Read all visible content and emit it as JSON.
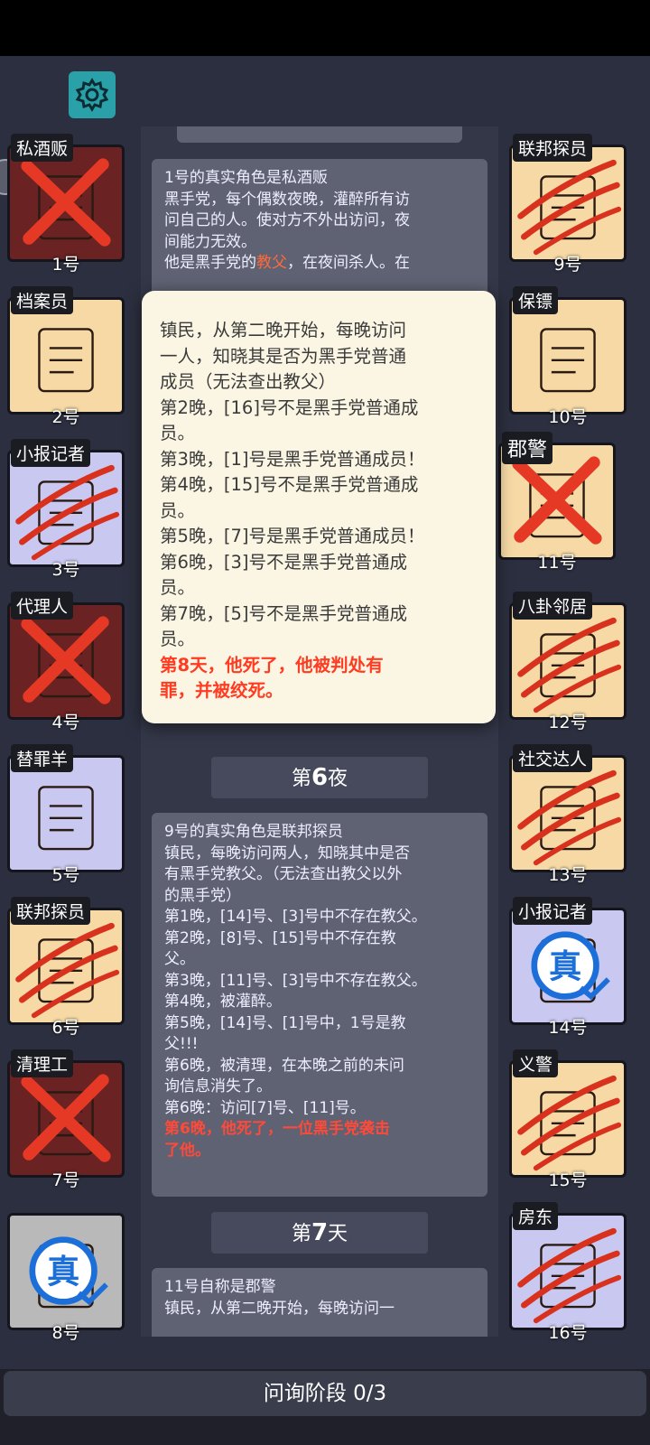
{
  "settings_icon": "gear-icon",
  "colors": {
    "accent_teal": "#2aa0a8",
    "dead_red": "#e53925",
    "claw_red": "#d8321f",
    "true_blue": "#1c6fd9"
  },
  "left_players": [
    {
      "role": "私酒贩",
      "num": "1号",
      "status": "dead-x"
    },
    {
      "role": "档案员",
      "num": "2号",
      "status": "alive"
    },
    {
      "role": "小报记者",
      "num": "3号",
      "status": "clawed"
    },
    {
      "role": "代理人",
      "num": "4号",
      "status": "dead-x"
    },
    {
      "role": "替罪羊",
      "num": "5号",
      "status": "alive"
    },
    {
      "role": "联邦探员",
      "num": "6号",
      "status": "clawed"
    },
    {
      "role": "清理工",
      "num": "7号",
      "status": "dead-x"
    },
    {
      "role": "",
      "num": "8号",
      "status": "true-stamp"
    }
  ],
  "right_players": [
    {
      "role": "联邦探员",
      "num": "9号",
      "status": "clawed"
    },
    {
      "role": "保镖",
      "num": "10号",
      "status": "alive"
    },
    {
      "role": "郡警",
      "num": "11号",
      "status": "dead-x"
    },
    {
      "role": "八卦邻居",
      "num": "12号",
      "status": "clawed"
    },
    {
      "role": "社交达人",
      "num": "13号",
      "status": "clawed"
    },
    {
      "role": "小报记者",
      "num": "14号",
      "status": "true-stamp"
    },
    {
      "role": "义警",
      "num": "15号",
      "status": "clawed"
    },
    {
      "role": "房东",
      "num": "16号",
      "status": "clawed"
    }
  ],
  "true_stamp_text": "真",
  "feed": {
    "msg1": [
      "1号的真实角色是私酒贩",
      "黑手党，每个偶数夜晚，灌醉所有访",
      "问自己的人。使对方不外出访问，夜",
      "间能力无效。",
      "他是黑手党的",
      "教父",
      "，在夜间杀人。在"
    ],
    "header1": {
      "prefix": "第",
      "num": "6",
      "suffix": "夜"
    },
    "msg2": [
      "9号的真实角色是联邦探员",
      "镇民，每晚访问两人，知晓其中是否",
      "有黑手党教父。（无法查出教父以外",
      "的黑手党）",
      "第1晚，[14]号、[3]号中不存在教父。",
      "第2晚，[8]号、[15]号中不存在教",
      "父。",
      "第3晚，[11]号、[3]号中不存在教父。",
      "第4晚，被灌醉。",
      "第5晚，[14]号、[1]号中，1号是教",
      "父!!!",
      "第6晚，被清理，在本晚之前的未问",
      "询信息消失了。",
      "第6晚：访问[7]号、[11]号。"
    ],
    "msg2_red": [
      "第6晚，他死了，一位黑手党袭击",
      "了他。"
    ],
    "header2": {
      "prefix": "第",
      "num": "7",
      "suffix": "天"
    },
    "msg3": [
      "11号自称是郡警",
      "镇民，从第二晚开始，每晚访问一"
    ]
  },
  "popup": {
    "lines": [
      "镇民，从第二晚开始，每晚访问",
      "一人，知晓其是否为黑手党普通",
      "成员（无法查出教父）",
      "第2晚，[16]号不是黑手党普通成",
      "员。",
      "第3晚，[1]号是黑手党普通成员！",
      "第4晚，[15]号不是黑手党普通成",
      "员。",
      "第5晚，[7]号是黑手党普通成员！",
      "第6晚，[3]号不是黑手党普通成",
      "员。",
      "第7晚，[5]号不是黑手党普通成",
      "员。"
    ],
    "red_lines": [
      "第8天，他死了，他被判处有",
      "罪，并被绞死。"
    ]
  },
  "phase_label": "问询阶段 0/3"
}
